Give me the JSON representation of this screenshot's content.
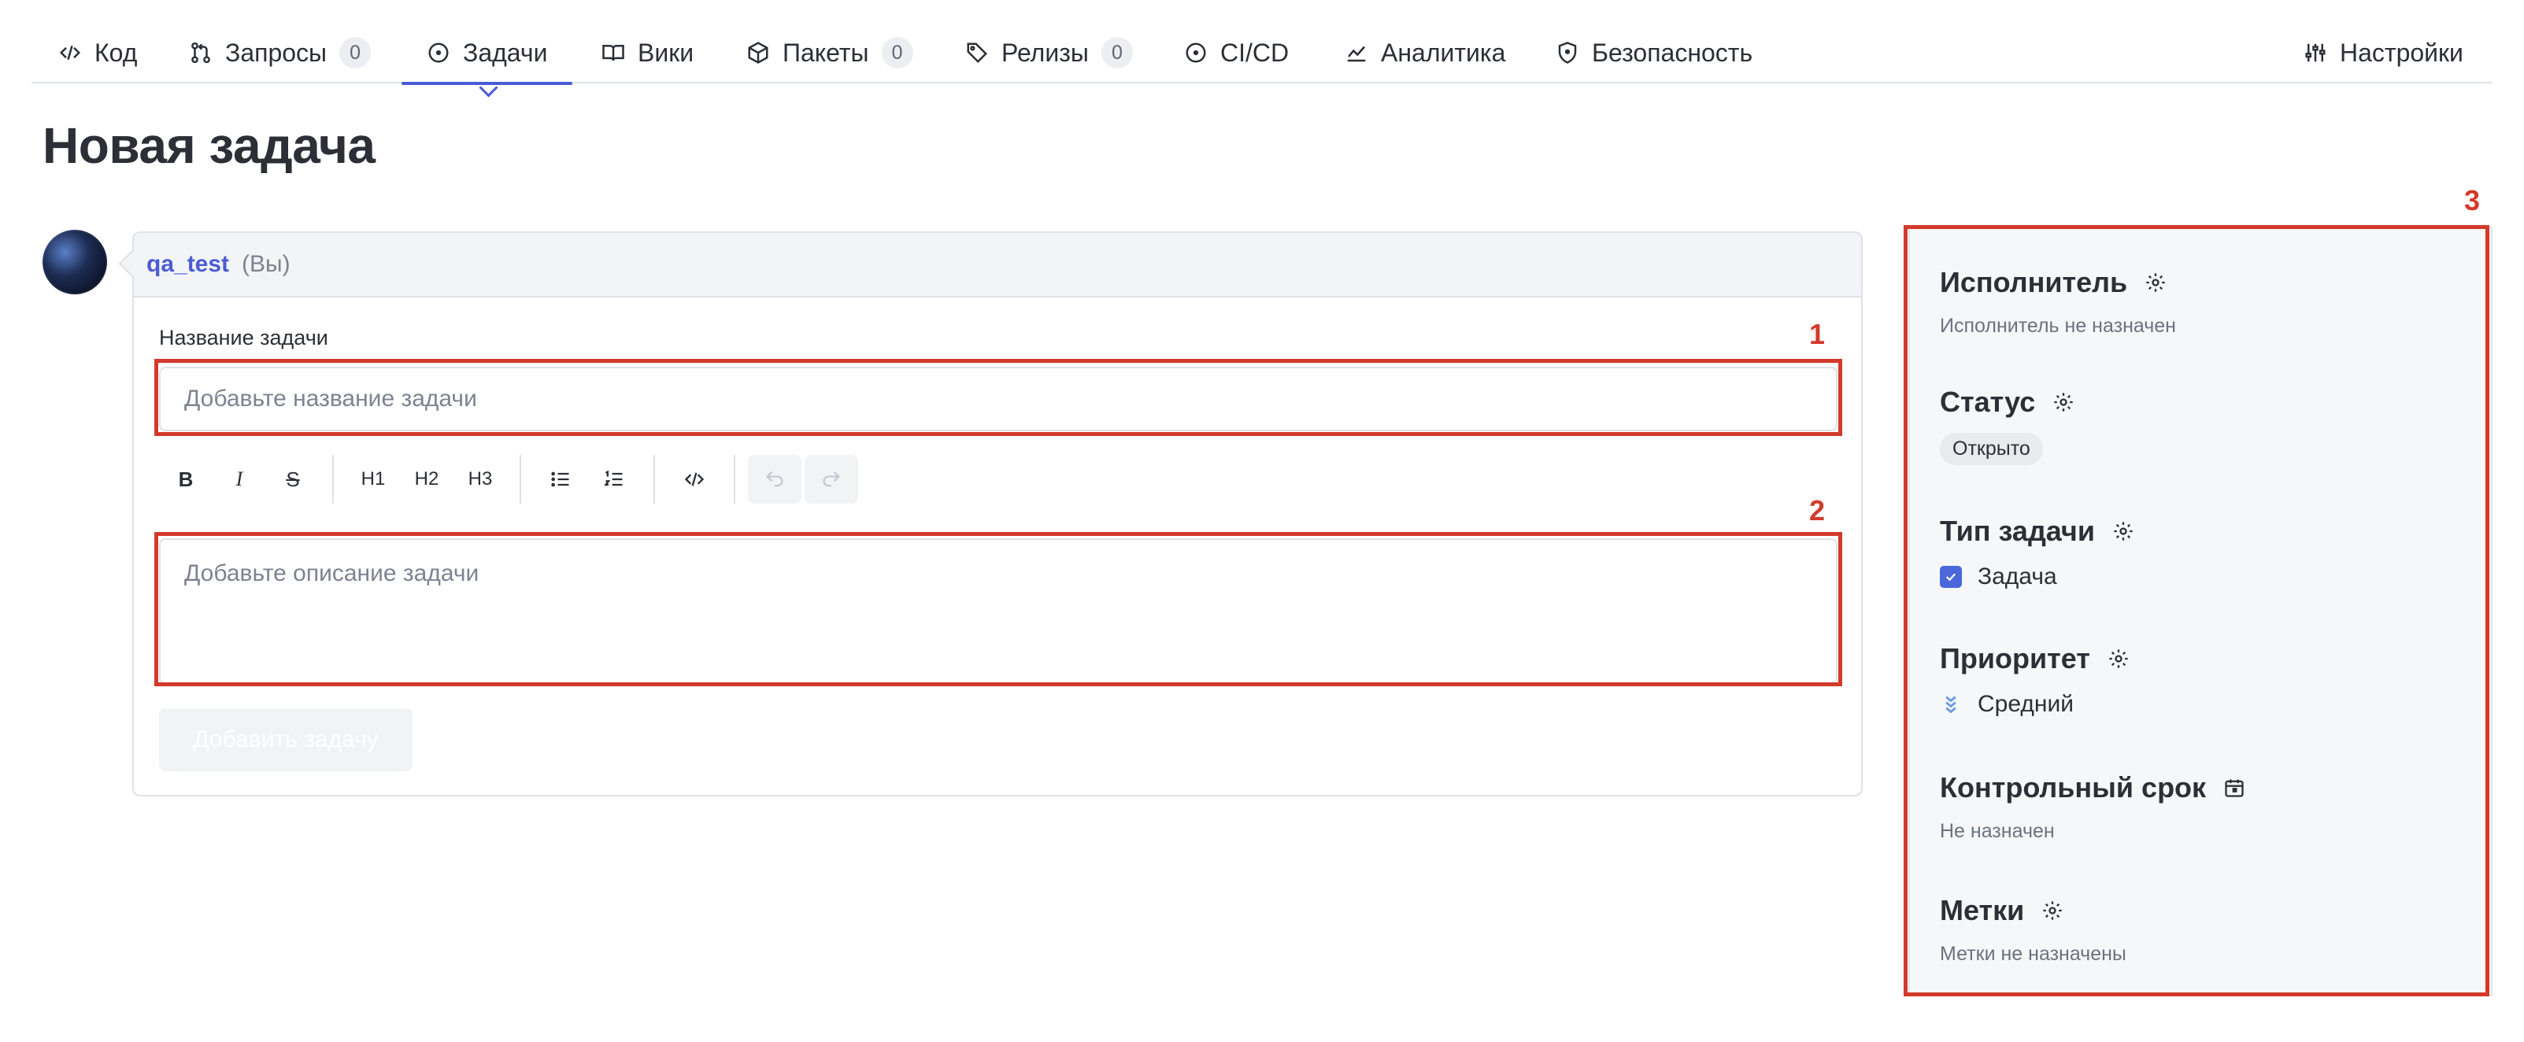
{
  "nav": {
    "tabs": [
      {
        "label": "Код",
        "icon": "code-icon"
      },
      {
        "label": "Запросы",
        "count": "0",
        "icon": "pull-request-icon"
      },
      {
        "label": "Задачи",
        "icon": "issue-icon",
        "active": true
      },
      {
        "label": "Вики",
        "icon": "book-icon"
      },
      {
        "label": "Пакеты",
        "count": "0",
        "icon": "package-icon"
      },
      {
        "label": "Релизы",
        "count": "0",
        "icon": "tag-icon"
      },
      {
        "label": "CI/CD",
        "icon": "play-circle-icon"
      },
      {
        "label": "Аналитика",
        "icon": "chart-icon"
      },
      {
        "label": "Безопасность",
        "icon": "shield-icon"
      }
    ],
    "settings_label": "Настройки"
  },
  "page_title": "Новая задача",
  "form": {
    "author": "qa_test",
    "author_suffix": "(Вы)",
    "title_label": "Название задачи",
    "title_placeholder": "Добавьте название задачи",
    "title_value": "",
    "toolbar": {
      "bold": "B",
      "italic": "I",
      "strike": "S",
      "h1": "H1",
      "h2": "H2",
      "h3": "H3"
    },
    "description_placeholder": "Добавьте описание задачи",
    "submit_label": "Добавить задачу"
  },
  "sidebar": {
    "assignee": {
      "title": "Исполнитель",
      "value": "Исполнитель не назначен"
    },
    "status": {
      "title": "Статус",
      "value": "Открыто"
    },
    "type": {
      "title": "Тип задачи",
      "value": "Задача"
    },
    "priority": {
      "title": "Приоритет",
      "value": "Средний"
    },
    "due": {
      "title": "Контрольный срок",
      "value": "Не назначен"
    },
    "labels": {
      "title": "Метки",
      "value": "Метки не назначены"
    }
  },
  "annotations": [
    "1",
    "2",
    "3"
  ],
  "colors": {
    "accent": "#4a5bd4",
    "annotation": "#d33a2c",
    "checkbox": "#4a68d9",
    "priority_icon": "#6b9be0"
  }
}
